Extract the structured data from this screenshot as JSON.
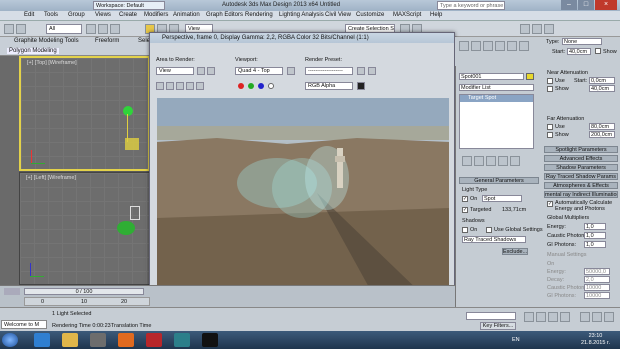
{
  "titlebar": {
    "app_title": "Autodesk 3ds Max Design 2013 x64    Untitled",
    "workspace": "Workspace: Default",
    "search_placeholder": "Type a keyword or phrase"
  },
  "menu": [
    "Edit",
    "Tools",
    "Group",
    "Views",
    "Create",
    "Modifiers",
    "Animation",
    "Graph Editors",
    "Rendering",
    "Lighting Analysis",
    "Civil View",
    "Customize",
    "MAXScript",
    "Help"
  ],
  "toolbar": {
    "filter": "All",
    "view_select": "View",
    "selection_set": "Create Selection Se"
  },
  "ribbon": {
    "tabs": [
      "Graphite Modeling Tools",
      "Freeform",
      "Selection"
    ],
    "polygon_modeling": "Polygon Modeling"
  },
  "viewports": {
    "top_label": "[+] [Top] [Wireframe]",
    "left_label": "[+] [Left] [Wireframe]"
  },
  "render_window": {
    "title": "Perspective, frame 0, Display Gamma: 2,2, RGBA Color 32 Bits/Channel (1:1)",
    "area_label": "Area to Render:",
    "area_value": "View",
    "viewport_label": "Viewport:",
    "viewport_value": "Quad 4 - Top",
    "preset_label": "Render Preset:",
    "preset_value": "-------------------",
    "channel": "RGB Alpha"
  },
  "command_panel": {
    "object_name": "Spot001",
    "modifier_list": "Modifier List",
    "stack_item": "Target Spot",
    "type_label": "Type:",
    "type_value": "None",
    "start_label": "Start:",
    "start_value": "40,0cm",
    "show": "Show",
    "near_atten": "Near Attenuation",
    "use": "Use",
    "near_start": "0,0cm",
    "near_end": "40,0cm",
    "far_atten": "Far Attenuation",
    "far_start": "80,0cm",
    "far_end": "200,0cm",
    "rollouts": [
      "Spotlight Parameters",
      "Advanced Effects",
      "Shadow Parameters",
      "Ray Traced Shadow Params",
      "Atmospheres & Effects"
    ],
    "mental_ray": "mental ray Indirect Illumination",
    "auto_calc": "Automatically Calculate Energy and Photons",
    "global_mult": "Global Multipliers",
    "energy_label": "Energy:",
    "energy_value": "1,0",
    "caustic_label": "Caustic Photons:",
    "caustic_value": "1,0",
    "gi_label": "GI Photons:",
    "gi_value": "1,0",
    "manual_label": "Manual Settings",
    "manual_rows": [
      {
        "label": "On",
        "value": ""
      },
      {
        "label": "Energy:",
        "value": "50000,0"
      },
      {
        "label": "Decay:",
        "value": "2,0"
      },
      {
        "label": "Caustic Photons:",
        "value": "10000"
      },
      {
        "label": "GI Photons:",
        "value": "10000"
      }
    ],
    "general_params": "General Parameters",
    "light_type": "Light Type",
    "on": "On",
    "light_value": "Spot",
    "targeted": "Targeted",
    "target_dist": "133,71cm",
    "shadows": "Shadows",
    "shadows_on": "On",
    "global_settings": "Use Global Settings",
    "shadow_type": "Ray Traced Shadows",
    "exclude": "Exclude..."
  },
  "timeline": {
    "frame": "0 / 100",
    "ticks": [
      "0",
      "10",
      "20"
    ]
  },
  "status": {
    "welcome": "Welcome to M",
    "selected": "1 Light Selected",
    "render_time": "Rendering Time  0:00:23",
    "translation_time": "Translation Time",
    "key_filters": "Key Filters..."
  },
  "taskbar": {
    "lang": "EN",
    "time": "23:10",
    "date": "21.8.2015 r."
  }
}
